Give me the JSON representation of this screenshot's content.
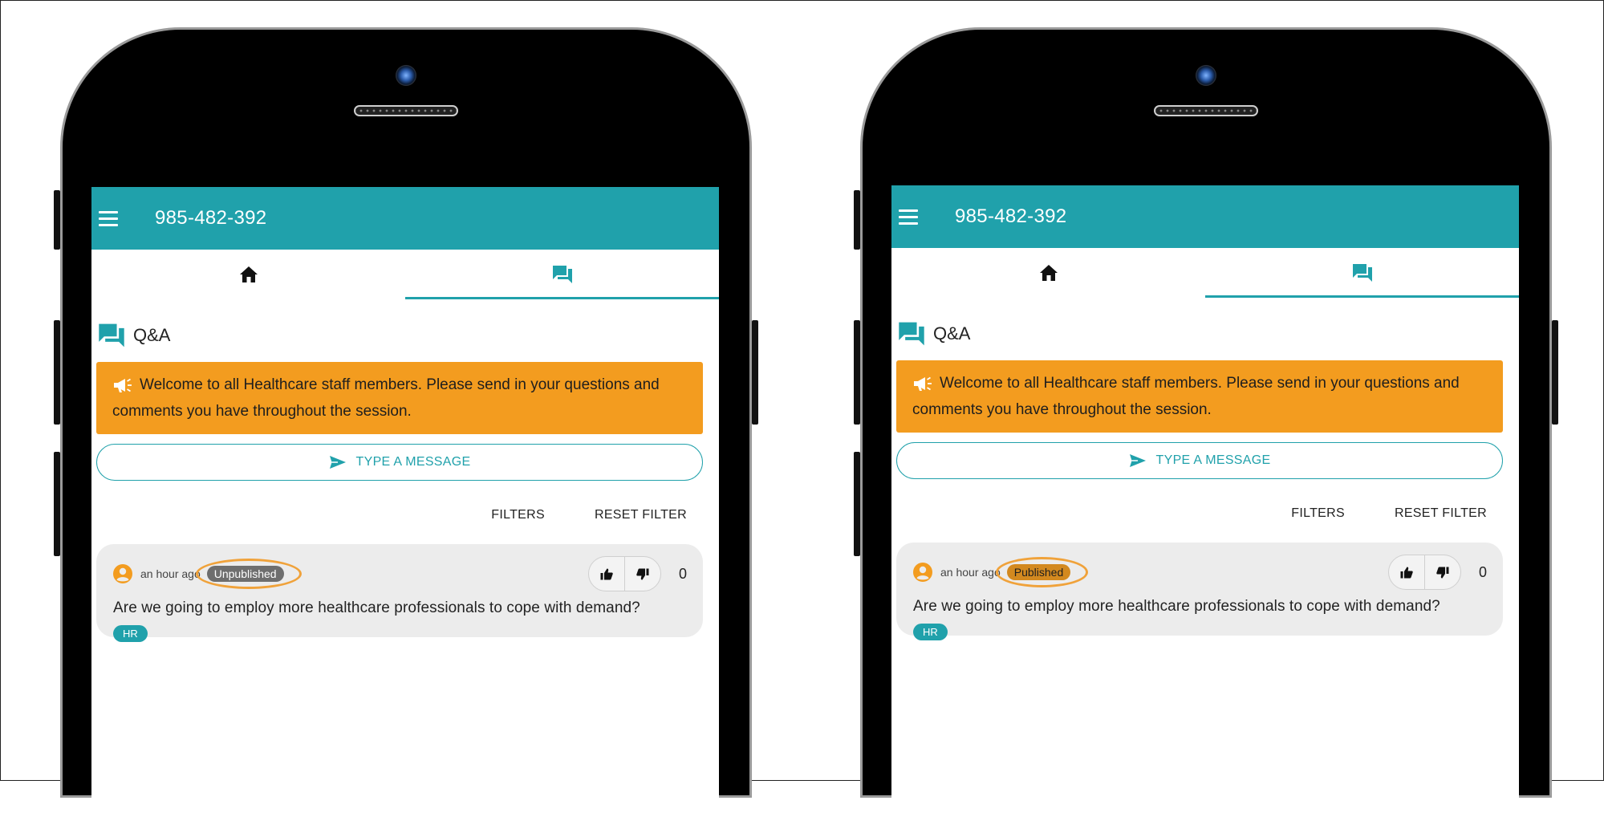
{
  "colors": {
    "brand_teal": "#20a1ab",
    "banner_orange": "#f39c1f",
    "unpublished_badge": "#6e6e6e",
    "published_badge": "#d3891f",
    "highlight_ring": "#f0a23a"
  },
  "phones": [
    {
      "appbar": {
        "title": "985-482-392"
      },
      "tabs": [
        {
          "icon": "home-icon"
        },
        {
          "icon": "chat-icon"
        }
      ],
      "section": {
        "title": "Q&A"
      },
      "banner": {
        "text": "Welcome to all Healthcare staff members. Please send in your questions and comments you have throughout the session."
      },
      "compose": {
        "label": "TYPE A MESSAGE"
      },
      "filters": {
        "filters_label": "FILTERS",
        "reset_label": "RESET FILTER"
      },
      "question": {
        "time": "an hour ago",
        "status": "Unpublished",
        "votes": "0",
        "text": "Are we going to employ more healthcare professionals to cope with demand?",
        "tag": "HR"
      }
    },
    {
      "appbar": {
        "title": "985-482-392"
      },
      "tabs": [
        {
          "icon": "home-icon"
        },
        {
          "icon": "chat-icon"
        }
      ],
      "section": {
        "title": "Q&A"
      },
      "banner": {
        "text": "Welcome to all Healthcare staff members. Please send in your questions and comments you have throughout the session."
      },
      "compose": {
        "label": "TYPE A MESSAGE"
      },
      "filters": {
        "filters_label": "FILTERS",
        "reset_label": "RESET FILTER"
      },
      "question": {
        "time": "an hour ago",
        "status": "Published",
        "votes": "0",
        "text": "Are we going to employ more healthcare professionals to cope with demand?",
        "tag": "HR"
      }
    }
  ]
}
